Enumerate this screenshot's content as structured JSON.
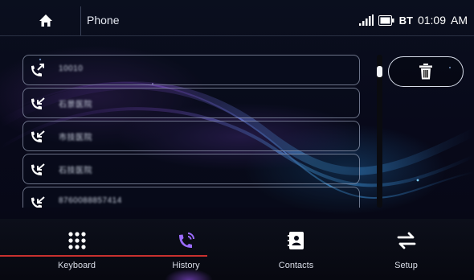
{
  "status_bar": {
    "title": "Phone",
    "bt_label": "BT",
    "time": "01:09",
    "ampm": "AM"
  },
  "call_list": {
    "items": [
      {
        "type": "outgoing",
        "text": "10010"
      },
      {
        "type": "incoming",
        "text": "石景医院"
      },
      {
        "type": "incoming",
        "text": "市技医院"
      },
      {
        "type": "incoming",
        "text": "石技医院"
      },
      {
        "type": "incoming",
        "text": "8760088857414"
      }
    ],
    "scroll_fraction": 0.08
  },
  "actions": {
    "delete_icon": "trash-icon"
  },
  "nav": {
    "items": [
      {
        "label": "Keyboard",
        "icon": "keypad-icon",
        "active": false
      },
      {
        "label": "History",
        "icon": "phone-history-icon",
        "active": true
      },
      {
        "label": "Contacts",
        "icon": "contacts-icon",
        "active": false
      },
      {
        "label": "Setup",
        "icon": "swap-arrows-icon",
        "active": false
      }
    ]
  },
  "colors": {
    "active_icon": "#9b6bff",
    "text": "#e8ecf5",
    "annotation_line": "#c8302e"
  }
}
